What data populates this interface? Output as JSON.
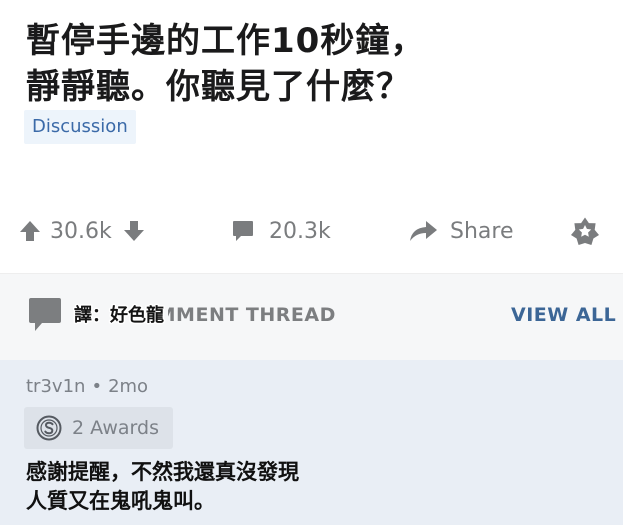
{
  "post": {
    "title_line1": "暫停手邊的工作10秒鐘，",
    "title_line2": "靜靜聽。你聽見了什麼？",
    "flair": "Discussion"
  },
  "actions": {
    "upvote_count": "30.6k",
    "comment_count": "20.3k",
    "share_label": "Share"
  },
  "thread": {
    "label": "OMMENT THREAD",
    "translator_tag": "譯：好色龍",
    "view_all": "VIEW ALL"
  },
  "comment": {
    "author": "tr3v1n",
    "separator": "•",
    "age": "2mo",
    "awards": "2 Awards",
    "body_line1": "感謝提醒，不然我還真沒發現",
    "body_line2": "人質又在鬼吼鬼叫。"
  },
  "colors": {
    "text_gray": "#7a7c7e",
    "link_blue": "#3c6696",
    "comment_bg": "#e9eef5"
  },
  "icons": [
    "arrow-up-icon",
    "arrow-down-icon",
    "comment-bubble-icon",
    "share-arrow-icon",
    "award-star-icon",
    "silver-award-icon"
  ]
}
